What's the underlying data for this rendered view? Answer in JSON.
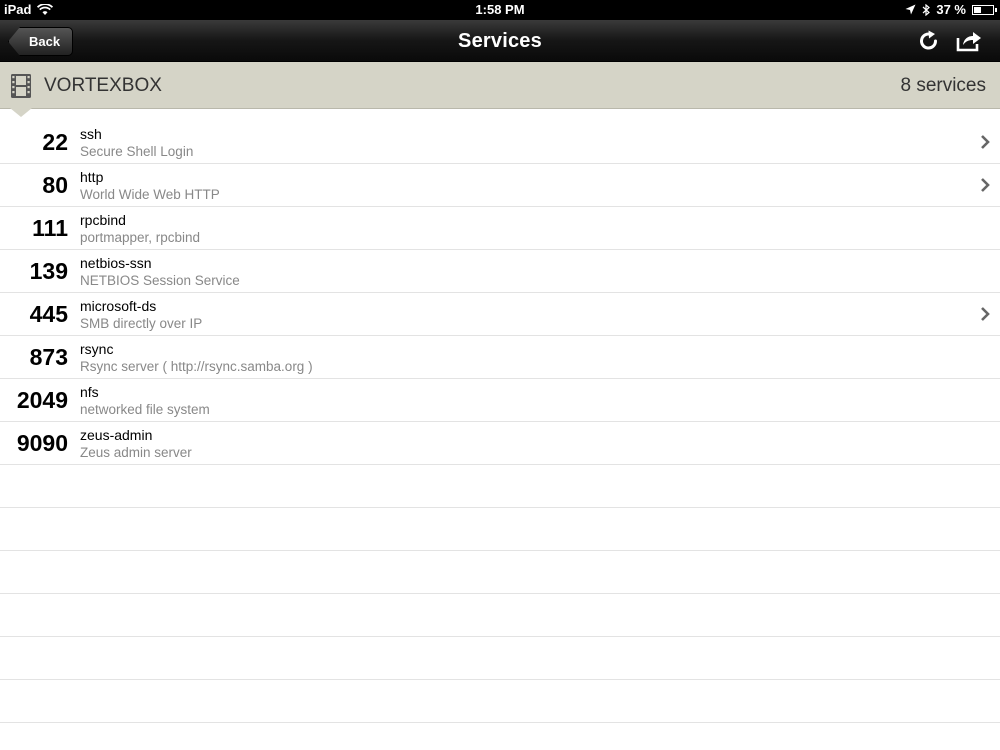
{
  "status_bar": {
    "device": "iPad",
    "time": "1:58 PM",
    "battery": "37 %",
    "battery_level": 0.37
  },
  "nav": {
    "back_label": "Back",
    "title": "Services"
  },
  "header": {
    "host": "VORTEXBOX",
    "count": "8 services"
  },
  "services": [
    {
      "port": "22",
      "name": "ssh",
      "description": "Secure Shell Login",
      "disclosure": true
    },
    {
      "port": "80",
      "name": "http",
      "description": "World Wide Web HTTP",
      "disclosure": true
    },
    {
      "port": "111",
      "name": "rpcbind",
      "description": "portmapper, rpcbind",
      "disclosure": false
    },
    {
      "port": "139",
      "name": "netbios-ssn",
      "description": "NETBIOS Session Service",
      "disclosure": false
    },
    {
      "port": "445",
      "name": "microsoft-ds",
      "description": "SMB directly over IP",
      "disclosure": true
    },
    {
      "port": "873",
      "name": "rsync",
      "description": "Rsync server ( http://rsync.samba.org )",
      "disclosure": false
    },
    {
      "port": "2049",
      "name": "nfs",
      "description": "networked file system",
      "disclosure": false
    },
    {
      "port": "9090",
      "name": "zeus-admin",
      "description": "Zeus admin server",
      "disclosure": false
    }
  ],
  "empty_rows": 7
}
